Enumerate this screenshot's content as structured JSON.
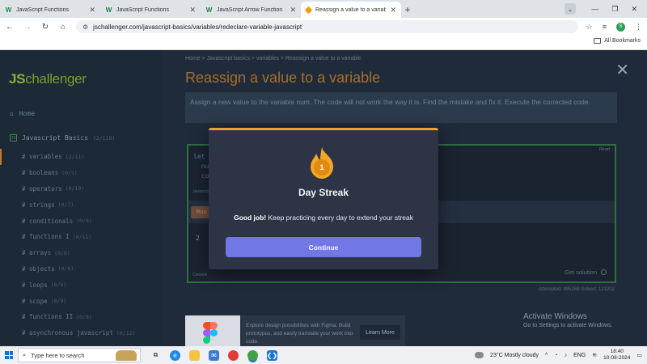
{
  "browser": {
    "tabs": [
      {
        "title": "JavaScript Functions",
        "favicon": "W",
        "active": false
      },
      {
        "title": "JavaScript Functions",
        "favicon": "W",
        "active": false
      },
      {
        "title": "JavaScript Arrow Function",
        "favicon": "W",
        "active": false
      },
      {
        "title": "Reassign a value to a variable |",
        "favicon": "js",
        "active": true
      }
    ],
    "url": "jschallenger.com/javascript-basics/variables/redeclare-variable-javascript",
    "all_bookmarks": "All Bookmarks",
    "profile_initial": "S"
  },
  "sidebar": {
    "logo_js": "JS",
    "logo_rest": "challenger",
    "home": "Home",
    "category": "Javascript Basics",
    "category_count": "(2/119)",
    "items": [
      {
        "label": "# variables",
        "count": "(2/11)",
        "active": true
      },
      {
        "label": "# booleans",
        "count": "(0/5)",
        "active": false
      },
      {
        "label": "# operators",
        "count": "(0/19)",
        "active": false
      },
      {
        "label": "# strings",
        "count": "(0/7)",
        "active": false
      },
      {
        "label": "# conditionals",
        "count": "(0/8)",
        "active": false
      },
      {
        "label": "# functions I",
        "count": "(0/11)",
        "active": false
      },
      {
        "label": "# arrays",
        "count": "(0/8)",
        "active": false
      },
      {
        "label": "# objects",
        "count": "(0/6)",
        "active": false
      },
      {
        "label": "# loops",
        "count": "(0/6)",
        "active": false
      },
      {
        "label": "# scope",
        "count": "(0/9)",
        "active": false
      },
      {
        "label": "# functions II",
        "count": "(0/8)",
        "active": false
      },
      {
        "label": "# asynchronous javascript",
        "count": "(0/12)",
        "active": false
      }
    ]
  },
  "content": {
    "breadcrumb": "Home > Javascript basics > variables > Reassign a value to a variable",
    "title": "Reassign a value to a variable",
    "description": "Assign a new value to the variable num. The code will not work the way it is. Find the mistake and fix it. Execute the corrected code.",
    "code_lines": [
      "let",
      "  nu",
      "  con"
    ],
    "reset_label": "Reset",
    "js_label": "Javascript",
    "run_label": "Run",
    "output_line": "2",
    "get_solution": "Get solution",
    "console_label": "Console",
    "stats": "Attempted: 885268   Solved: 121202"
  },
  "ad": {
    "text": "Explore design possibilities with Figma. Build prototypes, and easily translate your work into code.",
    "button": "Learn More"
  },
  "activate": {
    "heading": "Activate Windows",
    "sub": "Go to Settings to activate Windows."
  },
  "modal": {
    "streak_number": "1",
    "title": "Day Streak",
    "message_bold": "Good job!",
    "message_rest": " Keep practicing every day to extend your streak",
    "button": "Continue"
  },
  "taskbar": {
    "search_placeholder": "Type here to search",
    "weather": "23°C  Mostly cloudy",
    "lang": "ENG",
    "time": "18:40",
    "date": "10-08-2024"
  },
  "colors": {
    "accent_orange": "#f0a02c",
    "button_purple": "#7277e6",
    "logo_green": "#8fae35",
    "title_brown": "#a86f2c"
  }
}
